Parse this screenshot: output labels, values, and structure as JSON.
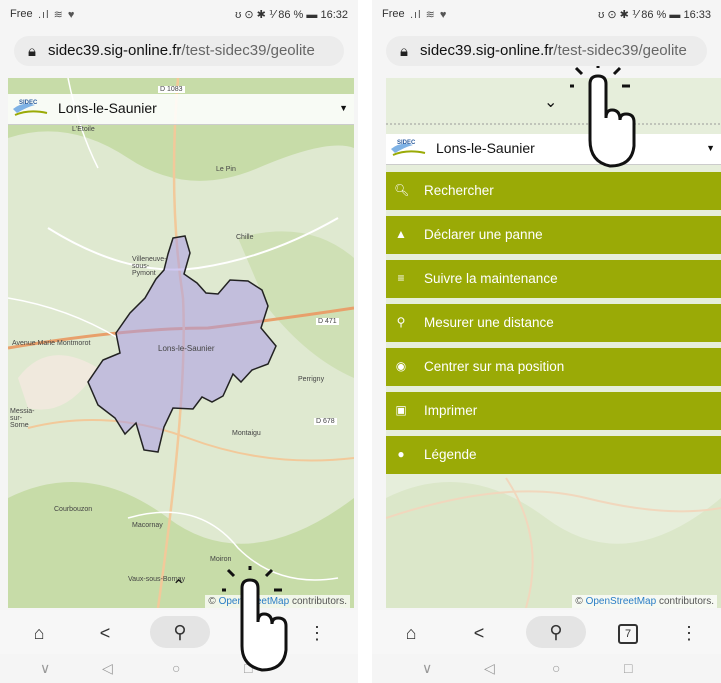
{
  "status_left": {
    "carrier": "Free",
    "signal": ".ıl ≋ ♥"
  },
  "status_right_left": {
    "icons": "ʊ ⊙ ✱ ⅟",
    "battery": "86 %",
    "time": "16:32"
  },
  "status_right_right": {
    "icons": "ʊ ⊙ ✱ ⅟",
    "battery": "86 %",
    "time": "16:33"
  },
  "url": {
    "domain": "sidec39.sig-online.fr",
    "path": "/test-sidec39/geolite"
  },
  "header": {
    "logo": "SIDEC",
    "logo_sub": "du Jura\nSYNDICAT MIXTE",
    "city": "Lons-le-Saunier",
    "caret": "▼"
  },
  "map_labels": {
    "ellipse": "L'Etoile",
    "montmorot": "Avenue Marie Montmorot",
    "villeneuve": "Villeneuve-sous-Pymont",
    "lepin": "Le Pin",
    "chille": "Chille",
    "lons": "Lons-le-Saunier",
    "perrigny": "Perrigny",
    "messia": "Messia-sur-Sorne",
    "montaigu": "Montaigu",
    "courbouzon": "Courbouzon",
    "macornay": "Macornay",
    "moiron": "Moiron",
    "vaux": "Vaux-sous-Bornay",
    "d1083": "D 1083",
    "d678": "D 678",
    "d470": "D 470",
    "d471": "D 471"
  },
  "attribution": {
    "prefix": "© ",
    "link": "OpenStreetMap",
    "suffix": " contributors."
  },
  "menu": [
    {
      "icon": "search-icon",
      "label": "Rechercher"
    },
    {
      "icon": "warning-icon",
      "label": "Déclarer une panne"
    },
    {
      "icon": "list-icon",
      "label": "Suivre la maintenance"
    },
    {
      "icon": "pin-icon",
      "label": "Mesurer une distance"
    },
    {
      "icon": "location-icon",
      "label": "Centrer sur ma position"
    },
    {
      "icon": "pdf-icon",
      "label": "Imprimer"
    },
    {
      "icon": "globe-icon",
      "label": "Légende"
    }
  ],
  "tabs_count": "7",
  "colors": {
    "menu": "#9aaa06",
    "zone_fill": "#a99be6",
    "zone_stroke": "#222222",
    "link": "#2b7ec6"
  }
}
